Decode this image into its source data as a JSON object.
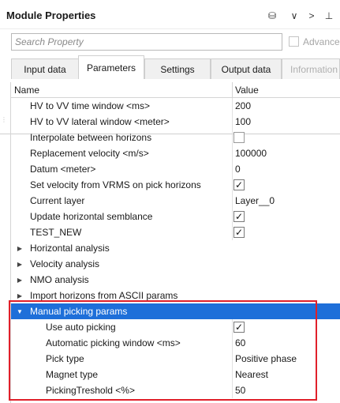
{
  "window": {
    "title": "Module Properties"
  },
  "toolbar": {
    "db_icon": "⛁",
    "chevron_down": "∨",
    "chevron_right": ">",
    "pin": "⊥"
  },
  "search": {
    "placeholder": "Search Property",
    "value": ""
  },
  "advanced": {
    "label": "Advanced",
    "checked": false
  },
  "tabs": [
    {
      "label": "Input data",
      "active": false,
      "disabled": false
    },
    {
      "label": "Parameters",
      "active": true,
      "disabled": false
    },
    {
      "label": "Settings",
      "active": false,
      "disabled": false
    },
    {
      "label": "Output data",
      "active": false,
      "disabled": false
    },
    {
      "label": "Information",
      "active": false,
      "disabled": true
    }
  ],
  "grid": {
    "columns": {
      "name": "Name",
      "value": "Value"
    },
    "rows": [
      {
        "name": "HV to VV time window <ms>",
        "value": "200"
      },
      {
        "name": "HV to VV lateral window <meter>",
        "value": "100"
      },
      {
        "name": "Interpolate between horizons",
        "checkbox": "unchecked"
      },
      {
        "name": "Replacement velocity <m/s>",
        "value": "100000"
      },
      {
        "name": "Datum <meter>",
        "value": "0"
      },
      {
        "name": "Set velocity from VRMS on pick horizons",
        "checkbox": "checked"
      },
      {
        "name": "Current layer",
        "value": "Layer__0"
      },
      {
        "name": "Update horizontal semblance",
        "checkbox": "checked"
      },
      {
        "name": "TEST_NEW",
        "checkbox": "checked"
      },
      {
        "name": "Horizontal analysis",
        "group": "collapsed"
      },
      {
        "name": "Velocity analysis",
        "group": "collapsed"
      },
      {
        "name": "NMO analysis",
        "group": "collapsed"
      },
      {
        "name": "Import horizons from ASCII params",
        "group": "collapsed"
      },
      {
        "name": "Manual picking params",
        "group": "expanded",
        "selected": true
      },
      {
        "name": "Use auto picking",
        "checkbox": "checked",
        "child": true
      },
      {
        "name": "Automatic picking window <ms>",
        "value": "60",
        "child": true
      },
      {
        "name": "Pick type",
        "value": "Positive phase",
        "child": true
      },
      {
        "name": "Magnet type",
        "value": "Nearest",
        "child": true
      },
      {
        "name": "PickingTreshold <%>",
        "value": "50",
        "child": true
      }
    ]
  },
  "icons": {
    "check": "✓",
    "collapsed": "▶",
    "expanded": "▼"
  },
  "colors": {
    "selection": "#1e6fd9",
    "highlight_border": "#e0202a"
  }
}
